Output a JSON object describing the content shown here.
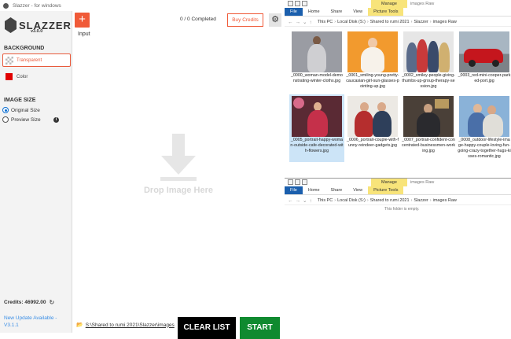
{
  "slazzer": {
    "window_title": "Slazzer - for windows",
    "logo_text": "SLAZZER",
    "version": "v3.0.0",
    "background_heading": "BACKGROUND",
    "bg_transparent_label": "Transparent",
    "bg_color_label": "Color",
    "bg_color_value": "#e00000",
    "image_size_heading": "IMAGE SIZE",
    "size_original_label": "Original Size",
    "size_preview_label": "Preview Size",
    "size_selected": "Original Size",
    "credits_text": "Credits: 46992.00",
    "update_line1": "New Update Available -",
    "update_line2": "V3.1.1",
    "add_label": "+",
    "completed_text": "0 / 0 Completed",
    "buy_credits_label": "Buy Credits",
    "input_label": "Input",
    "drop_text": "Drop Image Here",
    "folder_path": "S:\\Shared to rumi 2021\\Slazzer\\images",
    "clear_label": "CLEAR LIST",
    "start_label": "START",
    "accent_color": "#f05a38",
    "start_color": "#0f8a2f",
    "icons": [
      "slazzer-logo-icon",
      "add-icon",
      "gear-icon",
      "info-icon",
      "refresh-icon",
      "folder-icon",
      "download-arrow-icon"
    ]
  },
  "explorer_top": {
    "manage_label": "Manage",
    "folder_title": "images Raw",
    "tabs": [
      "File",
      "Home",
      "Share",
      "View",
      "Picture Tools"
    ],
    "breadcrumb": [
      "This PC",
      "Local Disk (S:)",
      "Shared to rumi 2021",
      "Slazzer",
      "images Raw"
    ],
    "files": [
      "_0000_woman-model-demonstrating-winter-cloths.jpg",
      "_0001_smiling-young-pretty-caucasian-girl-sun-glasses-pointing-up.jpg",
      "_0002_smiley-people-giving-thumbs-up-group-therapy-session.jpg",
      "_0003_red-mini-cooper-parked-port.jpg",
      "_0005_portrait-happy-woman-outside-cafe-decorated-with-flowers.jpg",
      "_0006_portrait-couple-with-funny-reindeer-gadgets.jpg",
      "_0007_portrait-confident-concentrated-businessmen-working.jpg",
      "_0008_outdoor-lifestyle-image-happy-couple-loving-fun-going-crazy-together-hugs-kisses-romantic.jpg"
    ]
  },
  "explorer_bottom": {
    "manage_label": "Manage",
    "folder_title": "images Raw",
    "tabs": [
      "File",
      "Home",
      "Share",
      "View",
      "Picture Tools"
    ],
    "breadcrumb": [
      "This PC",
      "Local Disk (S:)",
      "Shared to rumi 2021",
      "Slazzer",
      "images Raw"
    ],
    "empty_message": "This folder is empty."
  }
}
